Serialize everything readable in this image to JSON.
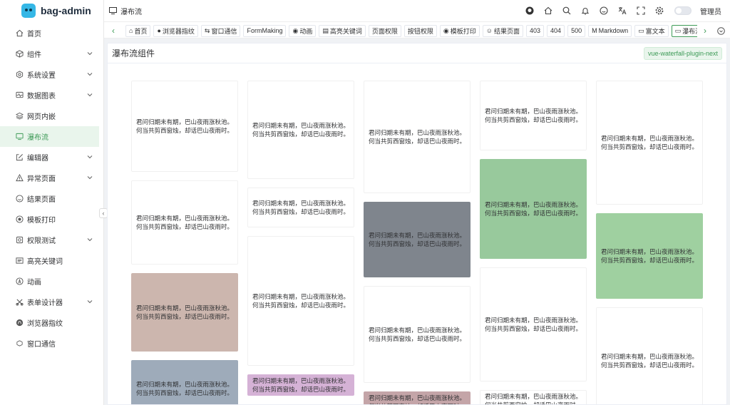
{
  "app": {
    "name": "bag-admin"
  },
  "sidebar": {
    "items": [
      {
        "label": "首页",
        "icon": "home-icon",
        "active": false,
        "has_children": false
      },
      {
        "label": "组件",
        "icon": "cube-icon",
        "active": false,
        "has_children": true
      },
      {
        "label": "系统设置",
        "icon": "settings-icon",
        "active": false,
        "has_children": true
      },
      {
        "label": "数据图表",
        "icon": "chart-icon",
        "active": false,
        "has_children": true
      },
      {
        "label": "网页内嵌",
        "icon": "layers-icon",
        "active": false,
        "has_children": false
      },
      {
        "label": "瀑布流",
        "icon": "monitor-icon",
        "active": true,
        "has_children": false
      },
      {
        "label": "编辑器",
        "icon": "edit-icon",
        "active": false,
        "has_children": true
      },
      {
        "label": "异常页面",
        "icon": "warning-icon",
        "active": false,
        "has_children": true
      },
      {
        "label": "结果页面",
        "icon": "smile-icon",
        "active": false,
        "has_children": false
      },
      {
        "label": "模板打印",
        "icon": "print-icon",
        "active": false,
        "has_children": false
      },
      {
        "label": "权限测试",
        "icon": "lock-icon",
        "active": false,
        "has_children": true
      },
      {
        "label": "高亮关键词",
        "icon": "highlight-icon",
        "active": false,
        "has_children": false
      },
      {
        "label": "动画",
        "icon": "animation-icon",
        "active": false,
        "has_children": false
      },
      {
        "label": "表单设计器",
        "icon": "form-design-icon",
        "active": false,
        "has_children": true
      },
      {
        "label": "浏览器指纹",
        "icon": "fingerprint-icon",
        "active": false,
        "has_children": false
      },
      {
        "label": "窗口通信",
        "icon": "window-icon",
        "active": false,
        "has_children": false
      }
    ]
  },
  "header": {
    "breadcrumb": "瀑布流",
    "user": "管理员",
    "icons": [
      "github-icon",
      "home-icon",
      "search-icon",
      "bell-icon",
      "smile-icon",
      "translate-icon",
      "fullscreen-icon",
      "gear-icon"
    ]
  },
  "tags": [
    {
      "label": "首页",
      "icon": "⌂"
    },
    {
      "label": "浏览器指纹",
      "icon": "●"
    },
    {
      "label": "窗口通信",
      "icon": "⇆"
    },
    {
      "label": "FormMaking",
      "icon": ""
    },
    {
      "label": "动画",
      "icon": "◉"
    },
    {
      "label": "高亮关键词",
      "icon": "▤"
    },
    {
      "label": "页面权限",
      "icon": ""
    },
    {
      "label": "按钮权限",
      "icon": ""
    },
    {
      "label": "模板打印",
      "icon": "◉"
    },
    {
      "label": "结果页面",
      "icon": "☺"
    },
    {
      "label": "403",
      "icon": ""
    },
    {
      "label": "404",
      "icon": ""
    },
    {
      "label": "500",
      "icon": ""
    },
    {
      "label": "Markdown",
      "icon": "M"
    },
    {
      "label": "富文本",
      "icon": "▭"
    },
    {
      "label": "瀑布流",
      "icon": "▭",
      "current": true
    }
  ],
  "card": {
    "title": "瀑布流组件",
    "badge": "vue-waterfall-plugin-next"
  },
  "waterfall": {
    "text": "君问归期未有期，巴山夜雨涨秋池。\n何当共剪西窗烛，却话巴山夜雨时。",
    "columns": [
      [
        {
          "color": "#ffffff"
        },
        {
          "color": "#ffffff"
        },
        {
          "color": "#ccb6ae"
        },
        {
          "color": "#9eabba"
        }
      ],
      [
        {
          "color": "#ffffff"
        },
        {
          "color": "#ffffff"
        },
        {
          "color": "#ffffff"
        },
        {
          "color": "#d5b2d6"
        }
      ],
      [
        {
          "color": "#ffffff"
        },
        {
          "color": "#7f858d"
        },
        {
          "color": "#ffffff"
        },
        {
          "color": "#c4a5a8"
        }
      ],
      [
        {
          "color": "#ffffff"
        },
        {
          "color": "#98c99c"
        },
        {
          "color": "#ffffff"
        },
        {
          "color": "#ffffff"
        }
      ],
      [
        {
          "color": "#ffffff"
        },
        {
          "color": "#9fd0a0"
        },
        {
          "color": "#ffffff"
        }
      ]
    ]
  }
}
